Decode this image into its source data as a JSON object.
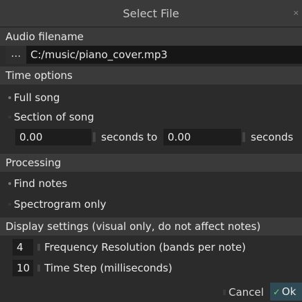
{
  "dialog": {
    "title": "Select File",
    "close_glyph": "×"
  },
  "audio": {
    "section_label": "Audio filename",
    "browse_label": "...",
    "filename_value": "C:/music/piano_cover.mp3"
  },
  "time": {
    "section_label": "Time options",
    "option_full": "Full song",
    "option_section": "Section of song",
    "start_value": "0.00",
    "to_label": "seconds to",
    "end_value": "0.00",
    "end_label": "seconds"
  },
  "processing": {
    "section_label": "Processing",
    "option_find": "Find notes",
    "option_spectrogram": "Spectrogram only"
  },
  "display": {
    "section_label": "Display settings (visual only, do not affect notes)",
    "freq_value": "4",
    "freq_label": "Frequency Resolution (bands per note)",
    "timestep_value": "10",
    "timestep_label": "Time Step (milliseconds)"
  },
  "buttons": {
    "cancel_label": "Cancel",
    "ok_label": "Ok",
    "ok_check": "✓"
  },
  "colors": {
    "background": "#2b2b2b",
    "section_bg": "#3a3a3a",
    "ok_bg": "#2f4a55",
    "check_color": "#6ed36e"
  }
}
